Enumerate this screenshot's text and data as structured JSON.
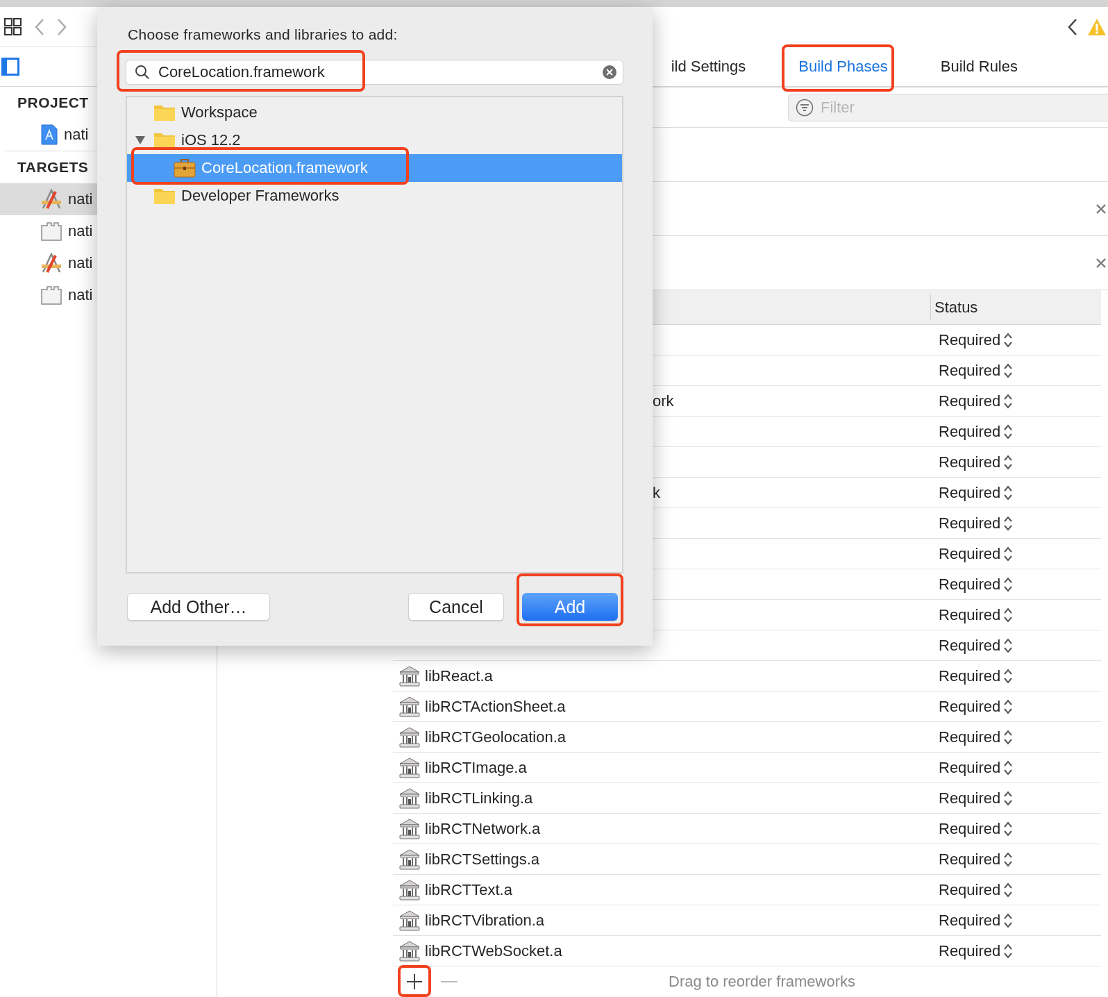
{
  "sidebar": {
    "sections": [
      {
        "title": "PROJECT",
        "items": [
          {
            "label": "nati",
            "kind": "project",
            "selected": false
          }
        ]
      },
      {
        "title": "TARGETS",
        "items": [
          {
            "label": "nati",
            "kind": "app",
            "selected": true
          },
          {
            "label": "nati",
            "kind": "bundle",
            "selected": false
          },
          {
            "label": "nati",
            "kind": "app",
            "selected": false
          },
          {
            "label": "nati",
            "kind": "bundle",
            "selected": false
          }
        ]
      }
    ]
  },
  "tabs": [
    {
      "label": "ild Settings",
      "selected": false,
      "highlighted": false
    },
    {
      "label": "Build Phases",
      "selected": true,
      "highlighted": true
    },
    {
      "label": "Build Rules",
      "selected": false,
      "highlighted": false
    }
  ],
  "filter": {
    "placeholder": "Filter"
  },
  "phases": [
    {
      "removable": true
    },
    {
      "removable": true
    }
  ],
  "table": {
    "columns": [
      "Status"
    ],
    "rows": [
      {
        "kind": "covered",
        "status": "Required"
      },
      {
        "kind": "covered",
        "status": "Required"
      },
      {
        "kind": "covered",
        "name": "ork",
        "status": "Required"
      },
      {
        "kind": "covered",
        "status": "Required"
      },
      {
        "kind": "covered",
        "status": "Required"
      },
      {
        "kind": "covered",
        "name": "k",
        "status": "Required"
      },
      {
        "kind": "covered",
        "status": "Required"
      },
      {
        "kind": "covered",
        "status": "Required"
      },
      {
        "kind": "covered",
        "status": "Required"
      },
      {
        "kind": "covered",
        "status": "Required"
      },
      {
        "kind": "covered",
        "status": "Required"
      },
      {
        "kind": "library",
        "name": "libReact.a",
        "status": "Required"
      },
      {
        "kind": "library",
        "name": "libRCTActionSheet.a",
        "status": "Required"
      },
      {
        "kind": "library",
        "name": "libRCTGeolocation.a",
        "status": "Required"
      },
      {
        "kind": "library",
        "name": "libRCTImage.a",
        "status": "Required"
      },
      {
        "kind": "library",
        "name": "libRCTLinking.a",
        "status": "Required"
      },
      {
        "kind": "library",
        "name": "libRCTNetwork.a",
        "status": "Required"
      },
      {
        "kind": "library",
        "name": "libRCTSettings.a",
        "status": "Required"
      },
      {
        "kind": "library",
        "name": "libRCTText.a",
        "status": "Required"
      },
      {
        "kind": "library",
        "name": "libRCTVibration.a",
        "status": "Required"
      },
      {
        "kind": "library",
        "name": "libRCTWebSocket.a",
        "status": "Required"
      }
    ]
  },
  "footer": {
    "add_highlighted": true,
    "hint": "Drag to reorder frameworks"
  },
  "dialog": {
    "title": "Choose frameworks and libraries to add:",
    "search": {
      "value": "CoreLocation.framework",
      "highlighted": true
    },
    "tree": [
      {
        "label": "Workspace",
        "kind": "folder",
        "selected": false
      },
      {
        "label": "iOS 12.2",
        "kind": "folder",
        "selected": false,
        "expanded": true,
        "children": [
          {
            "label": "CoreLocation.framework",
            "kind": "framework",
            "selected": true,
            "highlighted": true
          }
        ]
      },
      {
        "label": "Developer Frameworks",
        "kind": "folder",
        "selected": false
      }
    ],
    "buttons": [
      {
        "label": "Add Other…",
        "kind": "secondary",
        "highlighted": false
      },
      {
        "label": "Cancel",
        "kind": "secondary",
        "highlighted": false
      },
      {
        "label": "Add",
        "kind": "primary",
        "highlighted": true
      }
    ]
  }
}
